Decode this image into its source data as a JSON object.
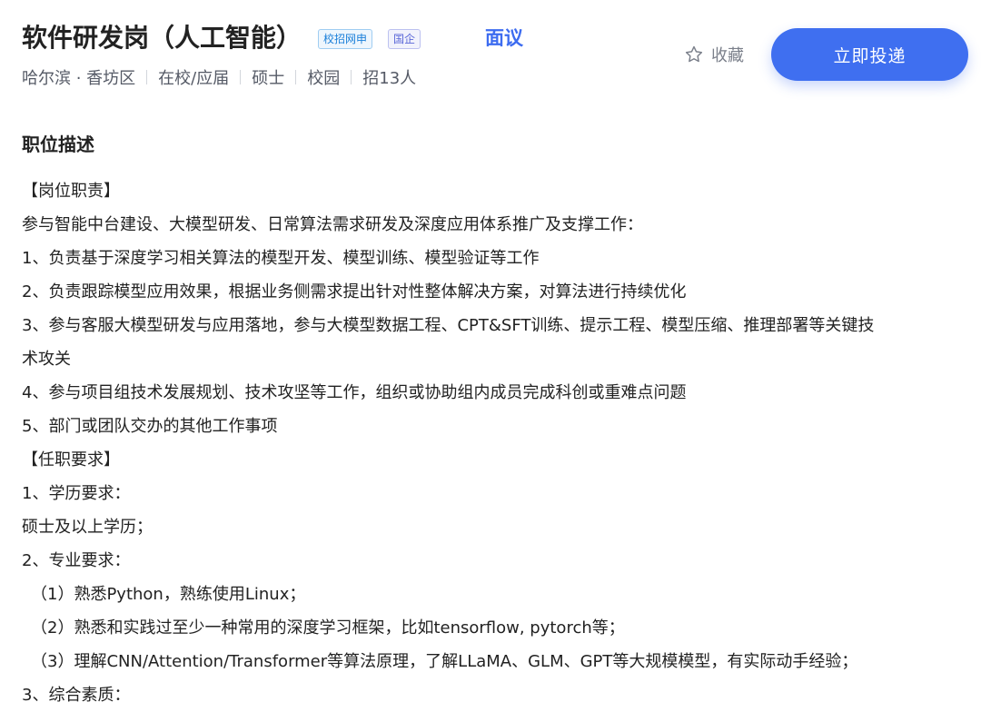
{
  "header": {
    "title": "软件研发岗（人工智能）",
    "tags": [
      "校招网申",
      "国企"
    ],
    "salary": "面议",
    "meta": [
      "哈尔滨 · 香坊区",
      "在校/应届",
      "硕士",
      "校园",
      "招13人"
    ],
    "favorite_label": "收藏",
    "apply_label": "立即投递"
  },
  "description": {
    "heading": "职位描述",
    "lines": [
      "【岗位职责】",
      "参与智能中台建设、大模型研发、日常算法需求研发及深度应用体系推广及支撑工作：",
      "1、负责基于深度学习相关算法的模型开发、模型训练、模型验证等工作",
      "2、负责跟踪模型应用效果，根据业务侧需求提出针对性整体解决方案，对算法进行持续优化",
      "3、参与客服大模型研发与应用落地，参与大模型数据工程、CPT&SFT训练、提示工程、模型压缩、推理部署等关键技",
      "术攻关",
      "4、参与项目组技术发展规划、技术攻坚等工作，组织或协助组内成员完成科创或重难点问题",
      "5、部门或团队交办的其他工作事项",
      "【任职要求】",
      "1、学历要求：",
      "硕士及以上学历；",
      "2、专业要求：",
      "（1）熟悉Python，熟练使用Linux；",
      "（2）熟悉和实践过至少一种常用的深度学习框架，比如tensorflow, pytorch等；",
      "（3）理解CNN/Attention/Transformer等算法原理，了解LLaMA、GLM、GPT等大规模模型，有实际动手经验；",
      "3、综合素质："
    ]
  },
  "colors": {
    "accent": "#3f6ff0",
    "salary": "#3d6cf0",
    "text": "#222222",
    "muted": "#555a66"
  },
  "icons": {
    "favorite": "star-outline-icon"
  }
}
